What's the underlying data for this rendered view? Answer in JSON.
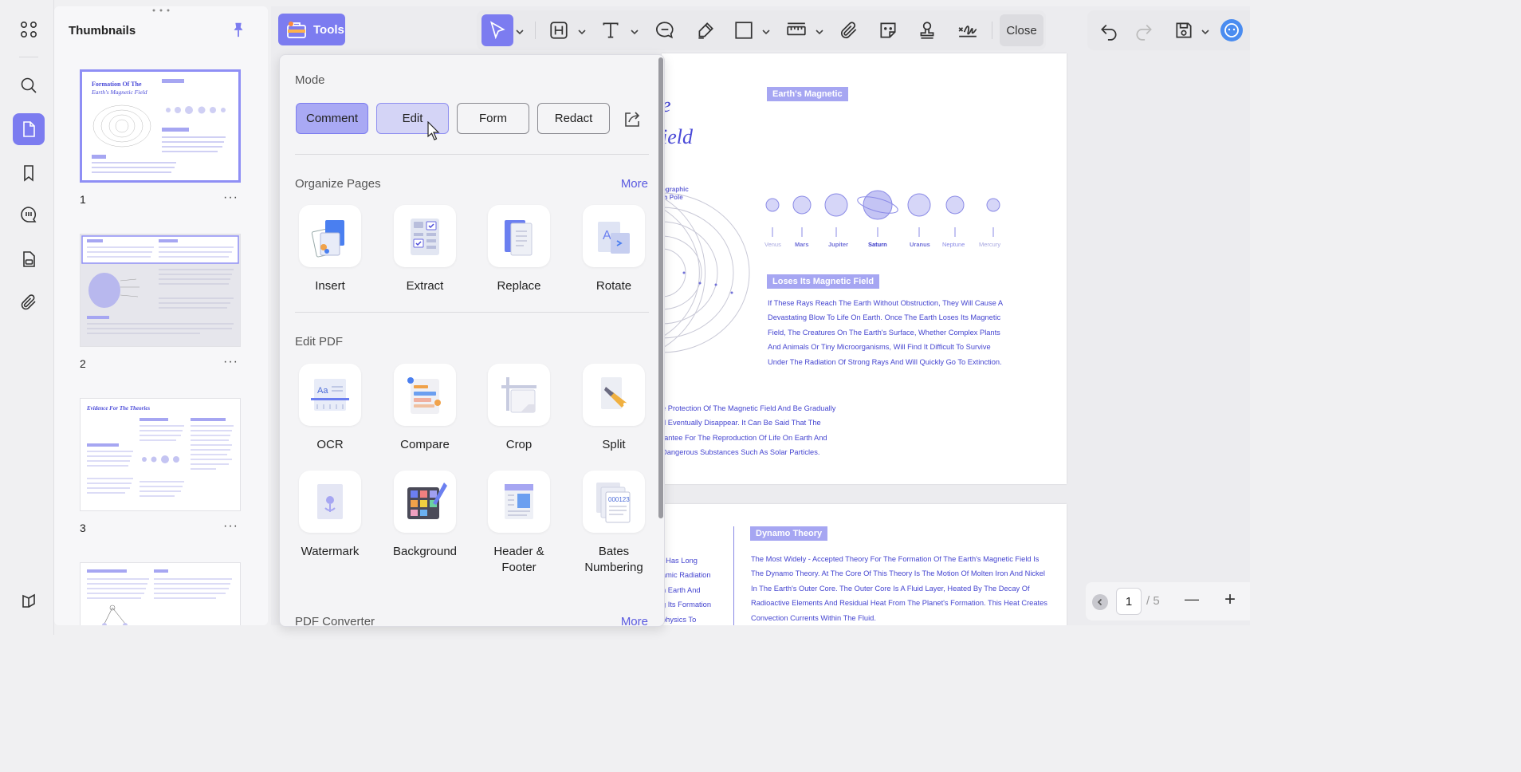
{
  "sidebar": {
    "items": [
      {
        "name": "apps-grid-icon"
      },
      {
        "name": "search-icon"
      },
      {
        "name": "pages-icon",
        "active": true
      },
      {
        "name": "bookmark-icon"
      },
      {
        "name": "comments-icon"
      },
      {
        "name": "attachments-panel-icon"
      },
      {
        "name": "paperclip-icon"
      }
    ],
    "bottom": {
      "name": "layers-icon"
    }
  },
  "thumbnails": {
    "title": "Thumbnails",
    "pages": [
      {
        "number": "1",
        "selected": true
      },
      {
        "number": "2"
      },
      {
        "number": "3"
      }
    ],
    "more": "···"
  },
  "toolbar": {
    "tools_label": "Tools",
    "close_label": "Close"
  },
  "panel": {
    "mode": {
      "title": "Mode",
      "buttons": [
        "Comment",
        "Edit",
        "Form",
        "Redact"
      ]
    },
    "organize": {
      "title": "Organize Pages",
      "more": "More",
      "tools": [
        "Insert",
        "Extract",
        "Replace",
        "Rotate"
      ]
    },
    "edit": {
      "title": "Edit PDF",
      "tools": [
        "OCR",
        "Compare",
        "Crop",
        "Split",
        "Watermark",
        "Background",
        "Header & Footer",
        "Bates Numbering"
      ]
    },
    "converter": {
      "title": "PDF Converter",
      "more": "More"
    }
  },
  "document": {
    "page1": {
      "heading_part1": "e",
      "heading_part2": "ield",
      "tag_magnetic": "Earth's Magnetic",
      "geo_label_1": "ographic",
      "geo_label_2": "th Pole",
      "planets": [
        "Venus",
        "Mars",
        "Jupiter",
        "Saturn",
        "Uranus",
        "Neptune",
        "Mercury"
      ],
      "tag_loses": "Loses Its Magnetic Field",
      "loses_lines": [
        "If These Rays Reach The Earth Without Obstruction, They Will Cause A",
        "Devastating Blow To Life On Earth. Once The Earth Loses Its Magnetic",
        "Field, The Creatures On The Earth's Surface, Whether Complex Plants",
        "And Animals Or Tiny Microorganisms, Will Find It Difficult To Survive",
        "Under The Radiation Of Strong Rays And Will Quickly Go To Extinction."
      ],
      "protect_lines": [
        "e Protection Of The Magnetic Field And Be Gradually",
        "d Eventually Disappear. It Can Be Said That The",
        "rantee For The Reproduction Of Life On Earth And",
        " Dangerous Substances Such As Solar Particles."
      ]
    },
    "page2": {
      "left_lines": [
        ", Has Long",
        "amic Radiation",
        "n Earth And",
        "g Its Formation",
        "physics To"
      ],
      "tag_dynamo": "Dynamo Theory",
      "dynamo_lines": [
        "The Most Widely - Accepted Theory For The Formation Of The Earth's Magnetic Field Is",
        "The Dynamo Theory. At The Core Of This Theory Is The Motion Of Molten Iron And Nickel",
        "In The Earth's Outer Core. The Outer Core Is A Fluid Layer, Heated By The Decay Of",
        "Radioactive Elements And Residual Heat From The Planet's Formation. This Heat Creates",
        "Convection Currents Within The Fluid."
      ]
    }
  },
  "pager": {
    "current_page": "1",
    "total": "/ 5",
    "zoom_out": "—",
    "zoom_in": "+"
  },
  "colors": {
    "accent": "#7c7cf0",
    "doc_text": "#4545d0",
    "tag_bg": "#a6a6f2"
  }
}
